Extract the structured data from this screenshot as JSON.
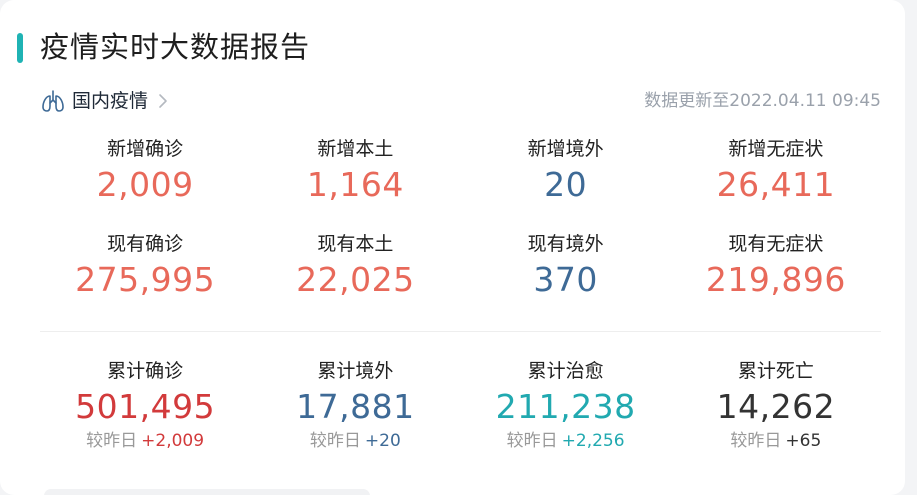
{
  "header": {
    "title": "疫情实时大数据报告"
  },
  "section": {
    "label": "国内疫情",
    "update_text": "数据更新至2022.04.11 09:45"
  },
  "colors": {
    "accent": "#1fb3b4",
    "red": "#e8695a",
    "blue": "#3e6a96",
    "dark_red": "#d23a3b",
    "teal": "#21a9b0",
    "dark": "#333333"
  },
  "row1": [
    {
      "label": "新增确诊",
      "value": "2,009"
    },
    {
      "label": "新增本土",
      "value": "1,164"
    },
    {
      "label": "新增境外",
      "value": "20"
    },
    {
      "label": "新增无症状",
      "value": "26,411"
    }
  ],
  "row2": [
    {
      "label": "现有确诊",
      "value": "275,995"
    },
    {
      "label": "现有本土",
      "value": "22,025"
    },
    {
      "label": "现有境外",
      "value": "370"
    },
    {
      "label": "现有无症状",
      "value": "219,896"
    }
  ],
  "cumulative": {
    "compare_label": "较昨日",
    "items": [
      {
        "label": "累计确诊",
        "value": "501,495",
        "delta": "+2,009"
      },
      {
        "label": "累计境外",
        "value": "17,881",
        "delta": "+20"
      },
      {
        "label": "累计治愈",
        "value": "211,238",
        "delta": "+2,256"
      },
      {
        "label": "累计死亡",
        "value": "14,262",
        "delta": "+65"
      }
    ]
  },
  "icons": {
    "section": "lung-icon",
    "chevron": "chevron-right-icon"
  }
}
